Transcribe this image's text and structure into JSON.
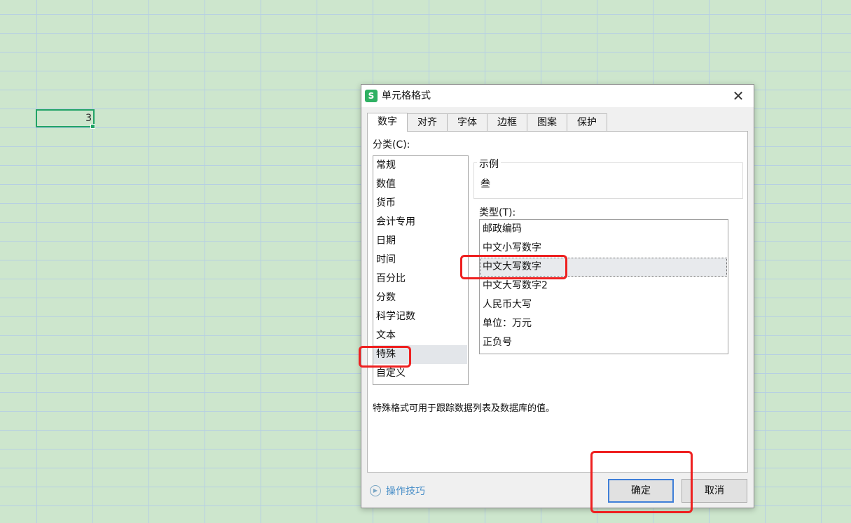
{
  "spreadsheet": {
    "selected_cell_value": "3"
  },
  "dialog": {
    "title": "单元格格式",
    "app_icon_letter": "S",
    "close_symbol": "✕",
    "tabs": [
      {
        "label": "数字"
      },
      {
        "label": "对齐"
      },
      {
        "label": "字体"
      },
      {
        "label": "边框"
      },
      {
        "label": "图案"
      },
      {
        "label": "保护"
      }
    ],
    "active_tab": "数字",
    "category_label": "分类(C):",
    "categories": [
      {
        "label": "常规"
      },
      {
        "label": "数值"
      },
      {
        "label": "货币"
      },
      {
        "label": "会计专用"
      },
      {
        "label": "日期"
      },
      {
        "label": "时间"
      },
      {
        "label": "百分比"
      },
      {
        "label": "分数"
      },
      {
        "label": "科学记数"
      },
      {
        "label": "文本"
      },
      {
        "label": "特殊"
      },
      {
        "label": "自定义"
      }
    ],
    "selected_category": "特殊",
    "sample": {
      "legend": "示例",
      "value": "叁"
    },
    "type_label": "类型(T):",
    "types": [
      {
        "label": "邮政编码"
      },
      {
        "label": "中文小写数字"
      },
      {
        "label": "中文大写数字"
      },
      {
        "label": "中文大写数字2"
      },
      {
        "label": "人民币大写"
      },
      {
        "label": "单位：万元"
      },
      {
        "label": "正负号"
      }
    ],
    "selected_type": "中文大写数字",
    "description": "特殊格式可用于跟踪数据列表及数据库的值。",
    "tips_label": "操作技巧",
    "tips_icon": "play-circle-icon",
    "ok_label": "确定",
    "cancel_label": "取消"
  },
  "colors": {
    "sheet_background": "#cde6cd",
    "gridline": "#b6cfe3",
    "cell_border": "#21a366",
    "annotation": "#ee2020",
    "ok_border": "#3f7fd8",
    "tips_text": "#4a8fc8"
  }
}
